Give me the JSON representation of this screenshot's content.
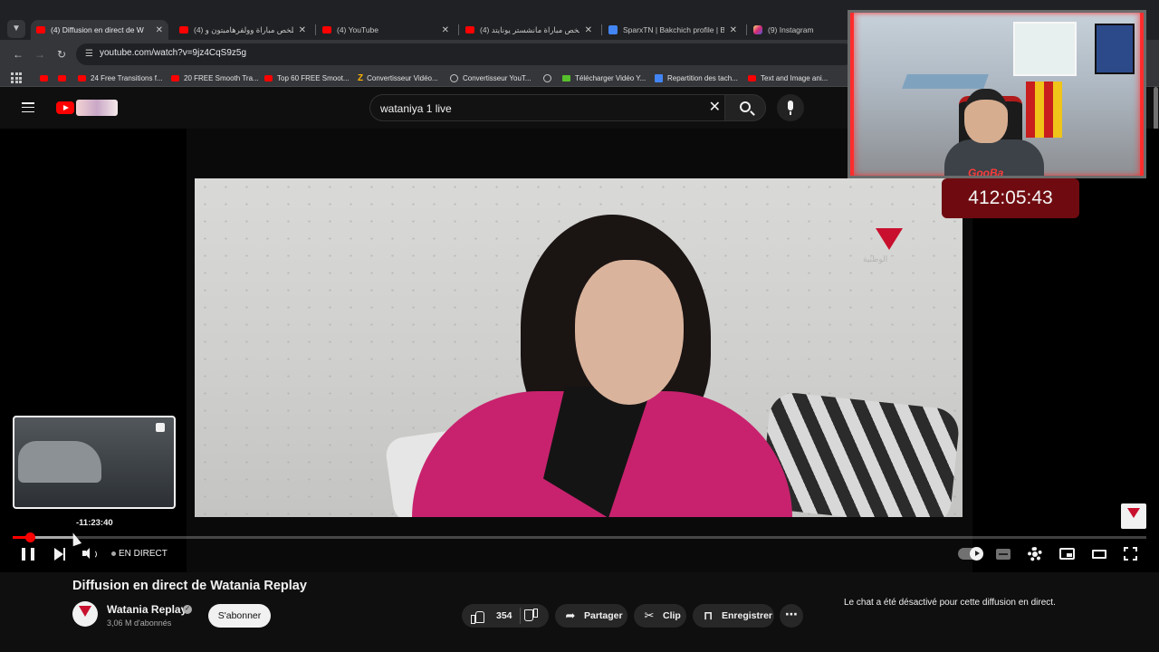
{
  "browser": {
    "tabs": [
      {
        "title": "(4) Diffusion en direct de W",
        "icon": "youtube-icon",
        "active": true
      },
      {
        "title": "(4) ملخص مباراة وولفرهامبتون و",
        "icon": "youtube-icon",
        "active": false
      },
      {
        "title": "(4) YouTube",
        "icon": "youtube-icon",
        "active": false
      },
      {
        "title": "(4) ملخص مباراة مانشستر يونايتد",
        "icon": "youtube-icon",
        "active": false
      },
      {
        "title": "SparxTN | Bakchich profile | Bak",
        "icon": "sparx-icon",
        "active": false
      },
      {
        "title": "(9) Instagram",
        "icon": "instagram-icon",
        "active": false
      }
    ],
    "url": "youtube.com/watch?v=9jz4CqS9z5g",
    "bookmarks": [
      {
        "label": "",
        "icon": "youtube-icon"
      },
      {
        "label": "",
        "icon": "youtube-icon"
      },
      {
        "label": "24 Free Transitions f...",
        "icon": "youtube-icon"
      },
      {
        "label": "20 FREE Smooth Tra...",
        "icon": "youtube-icon"
      },
      {
        "label": "Top 60 FREE Smoot...",
        "icon": "youtube-icon"
      },
      {
        "label": "Convertisseur Vidéo...",
        "icon": "z-icon"
      },
      {
        "label": "Convertisseur YouT...",
        "icon": "convert-icon"
      },
      {
        "label": "",
        "icon": "globe-icon"
      },
      {
        "label": "Télécharger Vidéo Y...",
        "icon": "download-icon"
      },
      {
        "label": "Repartition des tach...",
        "icon": "doc-icon"
      },
      {
        "label": "Text and Image ani...",
        "icon": "youtube-icon"
      }
    ]
  },
  "youtube": {
    "search_query": "wataniya 1 live",
    "player": {
      "preview_time": "-11:23:40",
      "live_label": "EN DIRECT",
      "progress_played": 0.015,
      "progress_hover": 0.055,
      "channel_watermark": "الوطنية"
    },
    "video": {
      "title": "Diffusion en direct de Watania Replay",
      "channel": "Watania Replay",
      "subscribers": "3,06 M d'abonnés",
      "subscribe_label": "S'abonner",
      "likes": "354",
      "share_label": "Partager",
      "clip_label": "Clip",
      "save_label": "Enregistrer"
    },
    "chat_message": "Le chat a été désactivé pour cette diffusion en direct."
  },
  "overlay": {
    "stream_timer": "412:05:43",
    "webcam_tag": "GooBa"
  },
  "colors": {
    "youtube_red": "#ff0000",
    "timer_bg": "#6f0b10",
    "pink_top": "#c8226e"
  }
}
